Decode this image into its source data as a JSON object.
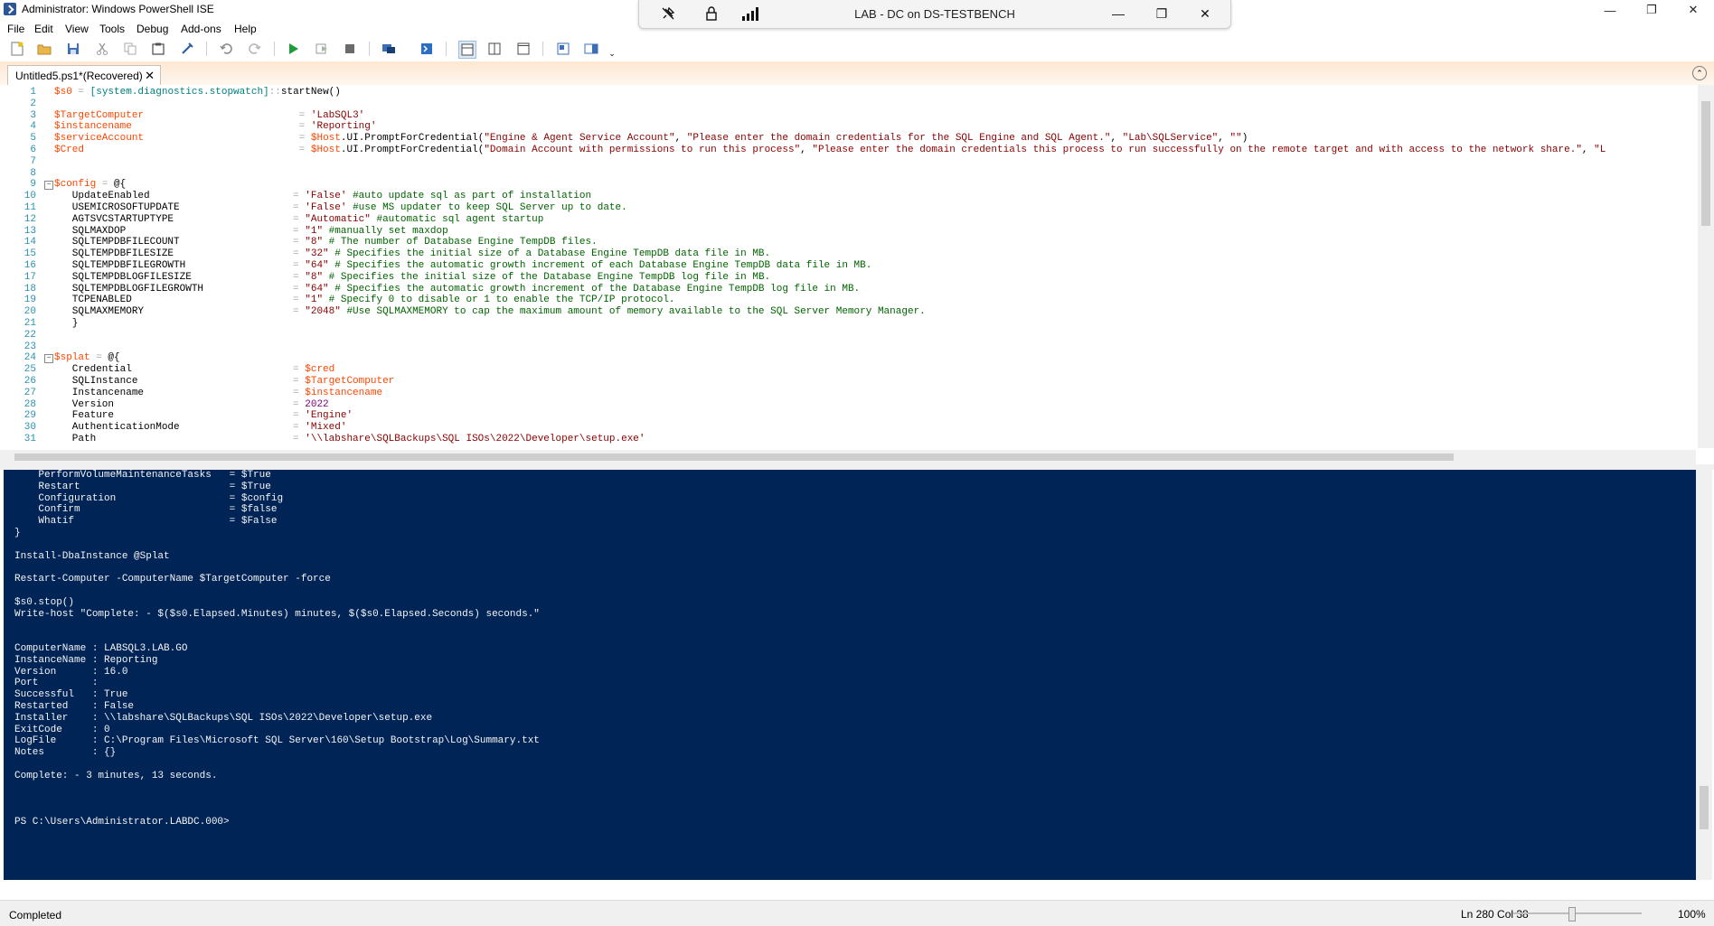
{
  "window": {
    "title": "Administrator: Windows PowerShell ISE",
    "controls": [
      "—",
      "❐",
      "✕"
    ]
  },
  "menu": [
    "File",
    "Edit",
    "View",
    "Tools",
    "Debug",
    "Add-ons",
    "Help"
  ],
  "rdp": {
    "title": "LAB - DC on DS-TESTBENCH",
    "controls": [
      "—",
      "❐",
      "✕"
    ]
  },
  "tab": {
    "label": "Untitled5.ps1*(Recovered)",
    "close": "✕"
  },
  "editor": {
    "lines": [
      {
        "n": "1",
        "fold": "",
        "tokens": [
          [
            "var",
            "$s0"
          ],
          [
            "op",
            " = "
          ],
          [
            "type",
            "[system.diagnostics.stopwatch]"
          ],
          [
            "op",
            "::"
          ],
          [
            "mem",
            "startNew()"
          ]
        ]
      },
      {
        "n": "2",
        "fold": "",
        "tokens": []
      },
      {
        "n": "3",
        "fold": "",
        "tokens": [
          [
            "var",
            "$TargetComputer"
          ],
          [
            "op",
            "                          = "
          ],
          [
            "str",
            "'LabSQL3'"
          ]
        ]
      },
      {
        "n": "4",
        "fold": "",
        "tokens": [
          [
            "var",
            "$instancename"
          ],
          [
            "op",
            "                            = "
          ],
          [
            "str",
            "'Reporting'"
          ]
        ]
      },
      {
        "n": "5",
        "fold": "",
        "tokens": [
          [
            "var",
            "$serviceAccount"
          ],
          [
            "op",
            "                          = "
          ],
          [
            "var",
            "$Host"
          ],
          [
            "mem",
            ".UI.PromptForCredential("
          ],
          [
            "str",
            "\"Engine & Agent Service Account\""
          ],
          [
            "mem",
            ", "
          ],
          [
            "str",
            "\"Please enter the domain credentials for the SQL Engine and SQL Agent.\""
          ],
          [
            "mem",
            ", "
          ],
          [
            "str",
            "\"Lab\\SQLService\""
          ],
          [
            "mem",
            ", "
          ],
          [
            "str",
            "\"\""
          ],
          [
            "mem",
            ")"
          ]
        ]
      },
      {
        "n": "6",
        "fold": "",
        "tokens": [
          [
            "var",
            "$Cred"
          ],
          [
            "op",
            "                                    = "
          ],
          [
            "var",
            "$Host"
          ],
          [
            "mem",
            ".UI.PromptForCredential("
          ],
          [
            "str",
            "\"Domain Account with permissions to run this process\""
          ],
          [
            "mem",
            ", "
          ],
          [
            "str",
            "\"Please enter the domain credentials this process to run successfully on the remote target and with access to the network share.\""
          ],
          [
            "mem",
            ", "
          ],
          [
            "str",
            "\"L"
          ]
        ]
      },
      {
        "n": "7",
        "fold": "",
        "tokens": []
      },
      {
        "n": "8",
        "fold": "",
        "tokens": []
      },
      {
        "n": "9",
        "fold": "⊟",
        "tokens": [
          [
            "var",
            "$config"
          ],
          [
            "op",
            " = "
          ],
          [
            "mem",
            "@{"
          ]
        ]
      },
      {
        "n": "10",
        "fold": "",
        "tokens": [
          [
            "mem",
            "   UpdateEnabled                        "
          ],
          [
            "op",
            "= "
          ],
          [
            "str",
            "'False'"
          ],
          [
            "cm",
            " #auto update sql as part of installation"
          ]
        ]
      },
      {
        "n": "11",
        "fold": "",
        "tokens": [
          [
            "mem",
            "   USEMICROSOFTUPDATE                   "
          ],
          [
            "op",
            "= "
          ],
          [
            "str",
            "'False'"
          ],
          [
            "cm",
            " #use MS updater to keep SQL Server up to date."
          ]
        ]
      },
      {
        "n": "12",
        "fold": "",
        "tokens": [
          [
            "mem",
            "   AGTSVCSTARTUPTYPE                    "
          ],
          [
            "op",
            "= "
          ],
          [
            "str",
            "\"Automatic\""
          ],
          [
            "cm",
            " #automatic sql agent startup"
          ]
        ]
      },
      {
        "n": "13",
        "fold": "",
        "tokens": [
          [
            "mem",
            "   SQLMAXDOP                            "
          ],
          [
            "op",
            "= "
          ],
          [
            "str",
            "\"1\""
          ],
          [
            "cm",
            " #manually set maxdop"
          ]
        ]
      },
      {
        "n": "14",
        "fold": "",
        "tokens": [
          [
            "mem",
            "   SQLTEMPDBFILECOUNT                   "
          ],
          [
            "op",
            "= "
          ],
          [
            "str",
            "\"8\""
          ],
          [
            "cm",
            " # The number of Database Engine TempDB files."
          ]
        ]
      },
      {
        "n": "15",
        "fold": "",
        "tokens": [
          [
            "mem",
            "   SQLTEMPDBFILESIZE                    "
          ],
          [
            "op",
            "= "
          ],
          [
            "str",
            "\"32\""
          ],
          [
            "cm",
            " # Specifies the initial size of a Database Engine TempDB data file in MB."
          ]
        ]
      },
      {
        "n": "16",
        "fold": "",
        "tokens": [
          [
            "mem",
            "   SQLTEMPDBFILEGROWTH                  "
          ],
          [
            "op",
            "= "
          ],
          [
            "str",
            "\"64\""
          ],
          [
            "cm",
            " # Specifies the automatic growth increment of each Database Engine TempDB data file in MB."
          ]
        ]
      },
      {
        "n": "17",
        "fold": "",
        "tokens": [
          [
            "mem",
            "   SQLTEMPDBLOGFILESIZE                 "
          ],
          [
            "op",
            "= "
          ],
          [
            "str",
            "\"8\""
          ],
          [
            "cm",
            " # Specifies the initial size of the Database Engine TempDB log file in MB."
          ]
        ]
      },
      {
        "n": "18",
        "fold": "",
        "tokens": [
          [
            "mem",
            "   SQLTEMPDBLOGFILEGROWTH               "
          ],
          [
            "op",
            "= "
          ],
          [
            "str",
            "\"64\""
          ],
          [
            "cm",
            " # Specifies the automatic growth increment of the Database Engine TempDB log file in MB."
          ]
        ]
      },
      {
        "n": "19",
        "fold": "",
        "tokens": [
          [
            "mem",
            "   TCPENABLED                           "
          ],
          [
            "op",
            "= "
          ],
          [
            "str",
            "\"1\""
          ],
          [
            "cm",
            " # Specify 0 to disable or 1 to enable the TCP/IP protocol."
          ]
        ]
      },
      {
        "n": "20",
        "fold": "",
        "tokens": [
          [
            "mem",
            "   SQLMAXMEMORY                         "
          ],
          [
            "op",
            "= "
          ],
          [
            "str",
            "\"2048\""
          ],
          [
            "cm",
            " #Use SQLMAXMEMORY to cap the maximum amount of memory available to the SQL Server Memory Manager."
          ]
        ]
      },
      {
        "n": "21",
        "fold": "",
        "tokens": [
          [
            "mem",
            "   }"
          ]
        ]
      },
      {
        "n": "22",
        "fold": "",
        "tokens": []
      },
      {
        "n": "23",
        "fold": "",
        "tokens": []
      },
      {
        "n": "24",
        "fold": "⊟",
        "tokens": [
          [
            "var",
            "$splat"
          ],
          [
            "op",
            " = "
          ],
          [
            "mem",
            "@{"
          ]
        ]
      },
      {
        "n": "25",
        "fold": "",
        "tokens": [
          [
            "mem",
            "   Credential                           "
          ],
          [
            "op",
            "= "
          ],
          [
            "var",
            "$cred"
          ]
        ]
      },
      {
        "n": "26",
        "fold": "",
        "tokens": [
          [
            "mem",
            "   SQLInstance                          "
          ],
          [
            "op",
            "= "
          ],
          [
            "var",
            "$TargetComputer"
          ]
        ]
      },
      {
        "n": "27",
        "fold": "",
        "tokens": [
          [
            "mem",
            "   Instancename                         "
          ],
          [
            "op",
            "= "
          ],
          [
            "var",
            "$instancename"
          ]
        ]
      },
      {
        "n": "28",
        "fold": "",
        "tokens": [
          [
            "mem",
            "   Version                              "
          ],
          [
            "op",
            "= "
          ],
          [
            "num",
            "2022"
          ]
        ]
      },
      {
        "n": "29",
        "fold": "",
        "tokens": [
          [
            "mem",
            "   Feature                              "
          ],
          [
            "op",
            "= "
          ],
          [
            "str",
            "'Engine'"
          ]
        ]
      },
      {
        "n": "30",
        "fold": "",
        "tokens": [
          [
            "mem",
            "   AuthenticationMode                   "
          ],
          [
            "op",
            "= "
          ],
          [
            "str",
            "'Mixed'"
          ]
        ]
      },
      {
        "n": "31",
        "fold": "",
        "tokens": [
          [
            "mem",
            "   Path                                 "
          ],
          [
            "op",
            "= "
          ],
          [
            "str",
            "'\\\\labshare\\SQLBackups\\SQL ISOs\\2022\\Developer\\setup.exe'"
          ]
        ]
      }
    ]
  },
  "console": {
    "lines": [
      "    PerformVolumeMaintenanceTasks   = $True",
      "    Restart                         = $True",
      "    Configuration                   = $config",
      "    Confirm                         = $false",
      "    Whatif                          = $False",
      "}",
      "",
      "Install-DbaInstance @Splat",
      "",
      "Restart-Computer -ComputerName $TargetComputer -force",
      "",
      "$s0.stop()",
      "Write-host \"Complete: - $($s0.Elapsed.Minutes) minutes, $($s0.Elapsed.Seconds) seconds.\"",
      "",
      "",
      "ComputerName : LABSQL3.LAB.GO",
      "InstanceName : Reporting",
      "Version      : 16.0",
      "Port         :",
      "Successful   : True",
      "Restarted    : False",
      "Installer    : \\\\labshare\\SQLBackups\\SQL ISOs\\2022\\Developer\\setup.exe",
      "ExitCode     : 0",
      "LogFile      : C:\\Program Files\\Microsoft SQL Server\\160\\Setup Bootstrap\\Log\\Summary.txt",
      "Notes        : {}",
      "",
      "Complete: - 3 minutes, 13 seconds.",
      "",
      "",
      "",
      "PS C:\\Users\\Administrator.LABDC.000>"
    ]
  },
  "status": {
    "text": "Completed",
    "position": "Ln 280  Col 38",
    "zoom": "100%",
    "zoom_level": 0.45
  },
  "colors": {
    "console_bg": "#012456",
    "variable": "#ff4500",
    "string": "#8b0000",
    "comment": "#006400",
    "line_number": "#2b91af"
  }
}
